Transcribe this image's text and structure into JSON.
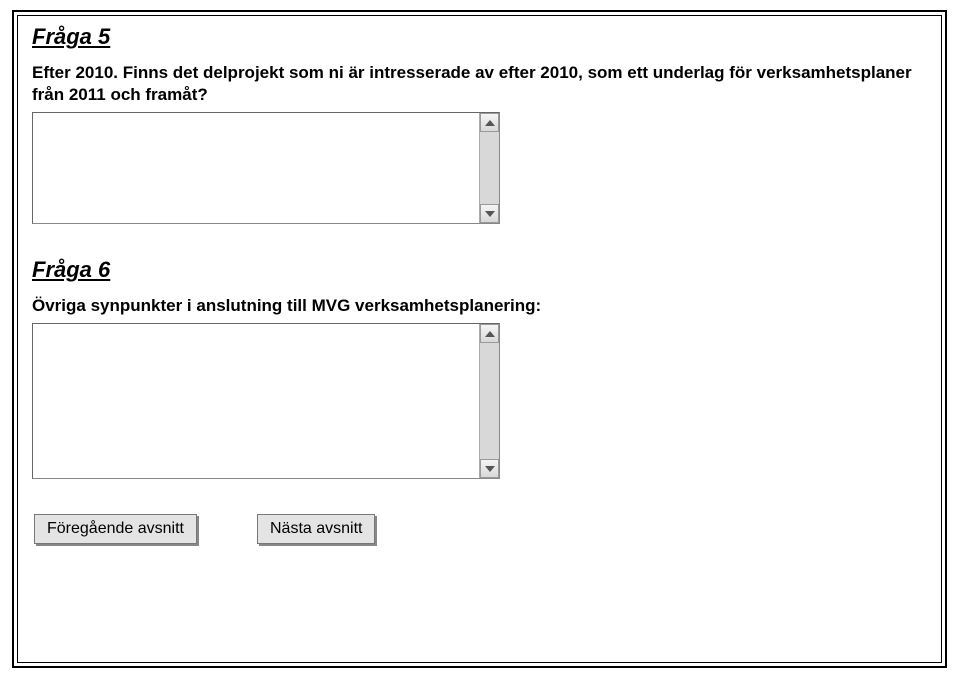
{
  "question5": {
    "title": "Fråga 5",
    "text": "Efter 2010. Finns det delprojekt som ni är intresserade av efter 2010, som ett underlag för verksamhetsplaner från 2011 och framåt?"
  },
  "question6": {
    "title": "Fråga 6",
    "text": "Övriga synpunkter i anslutning till MVG verksamhetsplanering:"
  },
  "buttons": {
    "prev": "Föregående avsnitt",
    "next": "Nästa avsnitt"
  }
}
